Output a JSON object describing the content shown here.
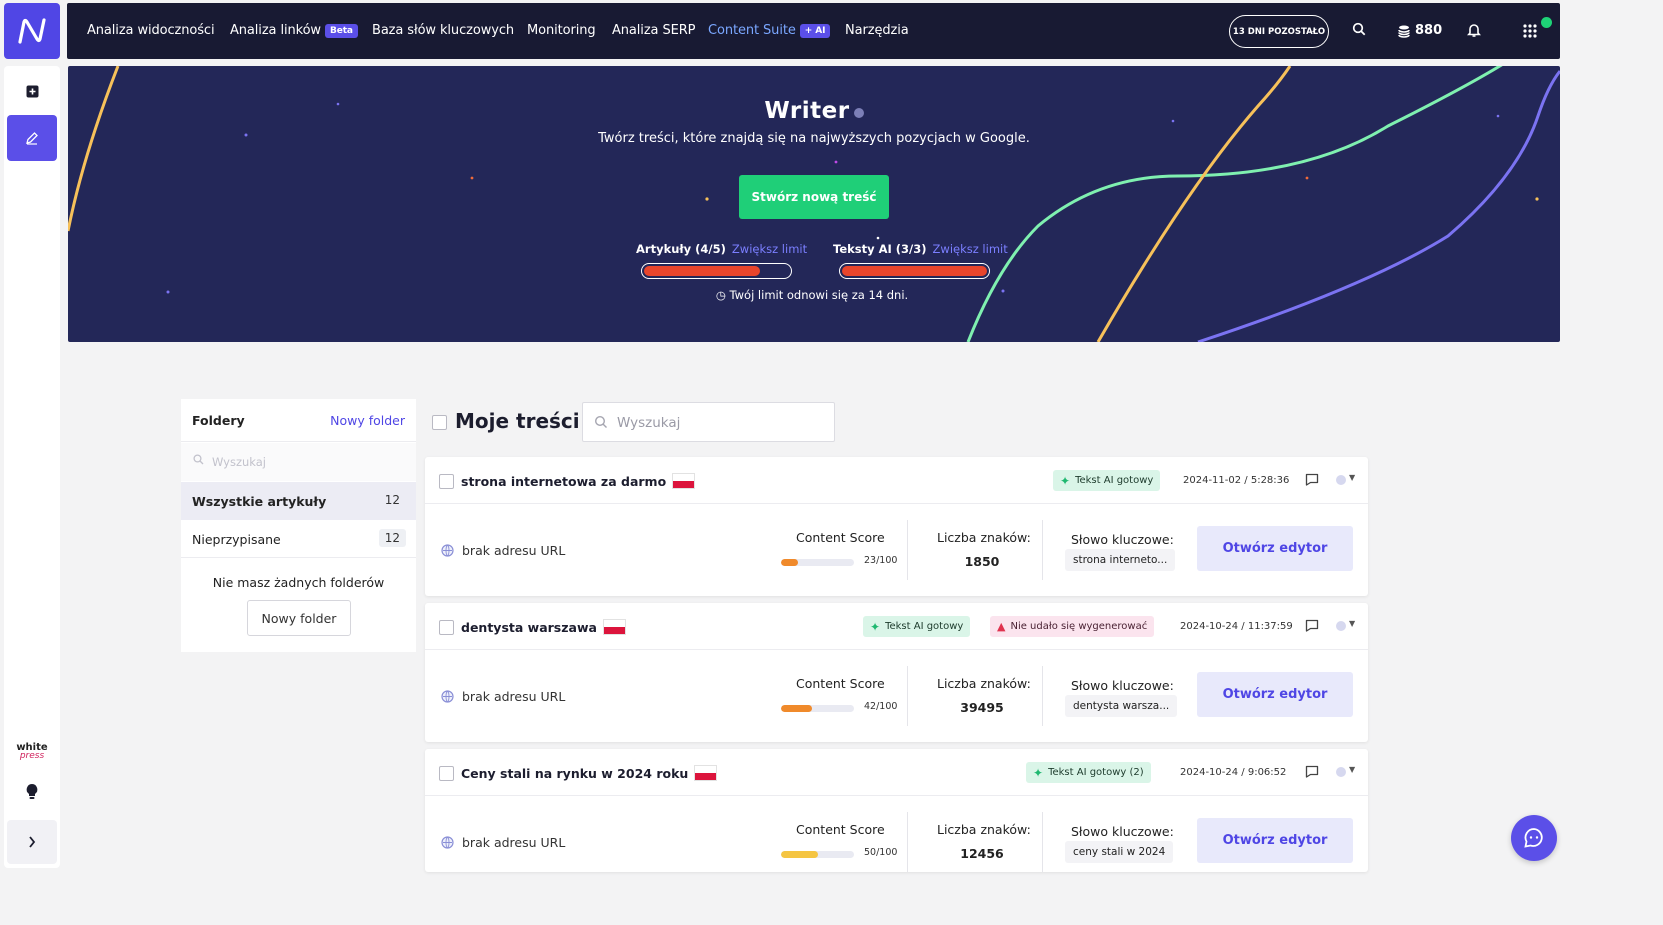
{
  "nav": {
    "items": [
      {
        "label": "Analiza widoczności",
        "badge": ""
      },
      {
        "label": "Analiza linków",
        "badge": "Beta"
      },
      {
        "label": "Baza słów kluczowych",
        "badge": ""
      },
      {
        "label": "Monitoring",
        "badge": ""
      },
      {
        "label": "Analiza SERP",
        "badge": ""
      },
      {
        "label": "Content Suite",
        "badge": "+ AI"
      },
      {
        "label": "Narzędzia",
        "badge": ""
      }
    ],
    "days_left": "13 DNI POZOSTAŁO",
    "credits": "880",
    "accent": "#7aa7ff"
  },
  "sidebar": {
    "logo_text": "white",
    "logo_sub": "press"
  },
  "hero": {
    "title": "Writer",
    "subtitle": "Twórz treści, które znajdą się na najwyższych pozycjach w Google.",
    "cta": "Stwórz nową treść",
    "limits": [
      {
        "label": "Artykuły (4/5)",
        "link": "Zwiększ limit",
        "progress": 0.8
      },
      {
        "label": "Teksty AI (3/3)",
        "link": "Zwiększ limit",
        "progress": 1.0
      }
    ],
    "reset_note": "Twój limit odnowi się za 14 dni."
  },
  "folders": {
    "title": "Foldery",
    "new_link": "Nowy folder",
    "search_placeholder": "Wyszukaj",
    "rows": [
      {
        "label": "Wszystkie artykuły",
        "count": "12"
      },
      {
        "label": "Nieprzypisane",
        "count": "12"
      }
    ],
    "empty_text": "Nie masz żadnych folderów",
    "new_button": "Nowy folder"
  },
  "content": {
    "title": "Moje treści",
    "search_placeholder": "Wyszukaj",
    "labels": {
      "no_url": "brak adresu URL",
      "content_score": "Content Score",
      "chars": "Liczba znaków:",
      "keyword": "Słowo kluczowe:",
      "open": "Otwórz edytor"
    },
    "cards": [
      {
        "title": "strona internetowa za darmo",
        "tags": [
          {
            "type": "ok",
            "text": "Tekst AI gotowy"
          }
        ],
        "date": "2024-11-02 / 5:28:36",
        "score": "23/100",
        "score_value": 23,
        "score_color": "#f08a2b",
        "chars": "1850",
        "keyword": "strona interneto..."
      },
      {
        "title": "dentysta warszawa",
        "tags": [
          {
            "type": "ok",
            "text": "Tekst AI gotowy"
          },
          {
            "type": "err",
            "text": "Nie udało się wygenerować"
          }
        ],
        "date": "2024-10-24 / 11:37:59",
        "score": "42/100",
        "score_value": 42,
        "score_color": "#f08a2b",
        "chars": "39495",
        "keyword": "dentysta warsza..."
      },
      {
        "title": "Ceny stali na rynku w 2024 roku",
        "tags": [
          {
            "type": "ok",
            "text": "Tekst AI gotowy (2)"
          }
        ],
        "date": "2024-10-24 / 9:06:52",
        "score": "50/100",
        "score_value": 50,
        "score_color": "#f5c542",
        "chars": "12456",
        "keyword": "ceny stali w 2024"
      }
    ]
  }
}
